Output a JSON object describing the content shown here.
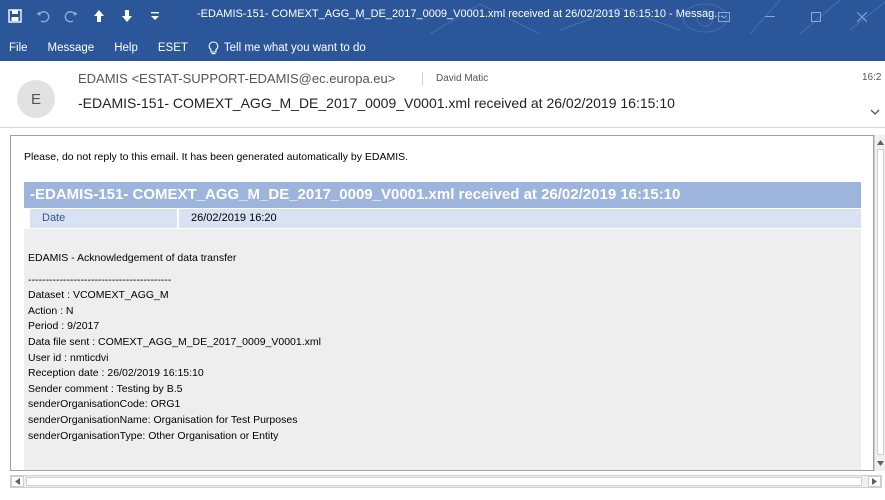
{
  "window": {
    "title": "-EDAMIS-151- COMEXT_AGG_M_DE_2017_0009_V0001.xml received at 26/02/2019 16:15:10  -  Messag...",
    "title_bar_color": "#2b579a"
  },
  "quick_access": [
    {
      "icon": "save-icon"
    },
    {
      "icon": "undo-icon"
    },
    {
      "icon": "redo-icon"
    },
    {
      "icon": "arrow-up-icon"
    },
    {
      "icon": "arrow-down-icon"
    },
    {
      "icon": "customize-qat-icon"
    }
  ],
  "window_controls": [
    {
      "icon": "ribbon-display-options-icon"
    },
    {
      "icon": "minimize-icon"
    },
    {
      "icon": "maximize-icon"
    },
    {
      "icon": "close-icon"
    }
  ],
  "menu": {
    "items": [
      {
        "label": "File"
      },
      {
        "label": "Message"
      },
      {
        "label": "Help"
      },
      {
        "label": "ESET"
      },
      {
        "label": "Tell me what you want to do",
        "icon": "lightbulb-icon"
      }
    ]
  },
  "header": {
    "avatar_initial": "E",
    "sender": "EDAMIS <ESTAT-SUPPORT-EDAMIS@ec.europa.eu>",
    "recipient": "David Matic",
    "time": "16:2",
    "subject": "-EDAMIS-151- COMEXT_AGG_M_DE_2017_0009_V0001.xml received at 26/02/2019 16:15:10"
  },
  "body": {
    "notice": "Please, do not reply to this email. It has been generated automatically by EDAMIS.",
    "message_header": "-EDAMIS-151- COMEXT_AGG_M_DE_2017_0009_V0001.xml received at 26/02/2019 16:15:10",
    "date_label": "Date",
    "date_value": "26/02/2019 16:20",
    "lines": [
      "EDAMIS - Acknowledgement of data transfer",
      "-----------------------------------------",
      "Dataset : VCOMEXT_AGG_M",
      "Action : N",
      "Period : 9/2017",
      "Data file sent : COMEXT_AGG_M_DE_2017_0009_V0001.xml",
      "User id : nmticdvi",
      "Reception date : 26/02/2019 16:15:10",
      "Sender comment : Testing by B.5",
      "senderOrganisationCode: ORG1",
      "senderOrganisationName: Organisation for Test Purposes",
      "senderOrganisationType: Other Organisation or Entity"
    ]
  },
  "colors": {
    "accent": "#2b579a",
    "message_header_bg": "#9db4dc",
    "date_row_bg": "#d9e2f3",
    "content_bg": "#eeeeee"
  }
}
